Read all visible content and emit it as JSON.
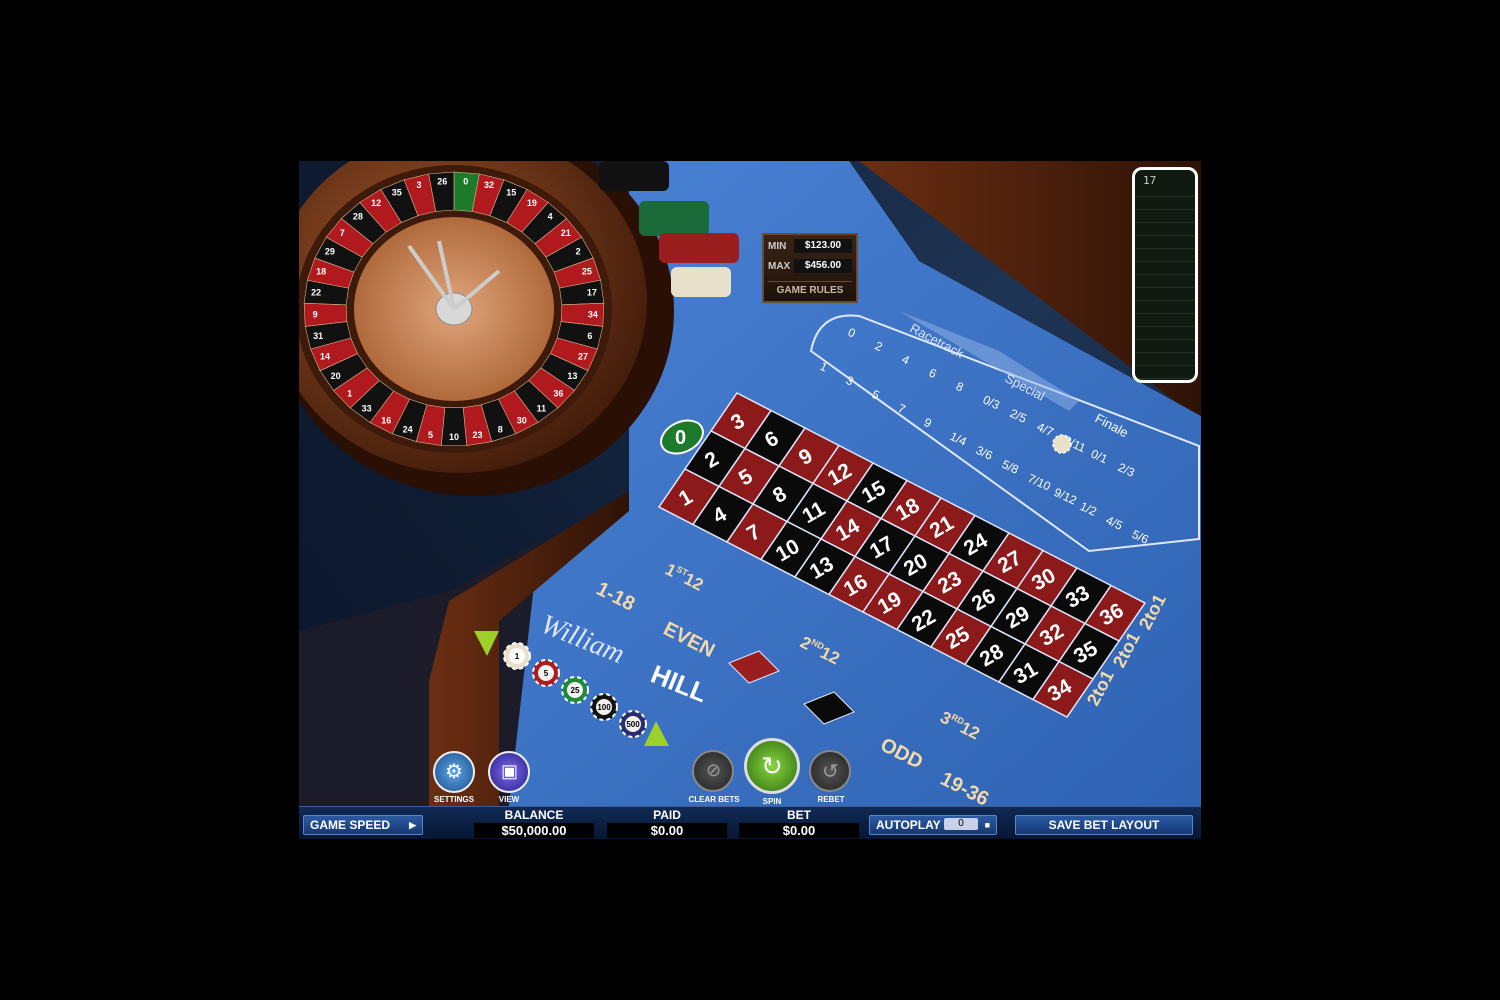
{
  "table": {
    "min_label": "MIN",
    "min_value": "$123.00",
    "max_label": "MAX",
    "max_value": "$456.00",
    "rules_label": "GAME RULES",
    "brand_script": "William",
    "brand_bold": "HILL",
    "zero": "0",
    "dozens": [
      {
        "n": "1",
        "sup": "ST",
        "t": "12"
      },
      {
        "n": "2",
        "sup": "ND",
        "t": "12"
      },
      {
        "n": "3",
        "sup": "RD",
        "t": "12"
      }
    ],
    "outside": {
      "low": "1-18",
      "even": "EVEN",
      "odd": "ODD",
      "high": "19-36",
      "column": "2to1"
    },
    "grid_rows": [
      [
        "3",
        "6",
        "9",
        "12",
        "15",
        "18",
        "21",
        "24",
        "27",
        "30",
        "33",
        "36"
      ],
      [
        "2",
        "5",
        "8",
        "11",
        "14",
        "17",
        "20",
        "23",
        "26",
        "29",
        "32",
        "35"
      ],
      [
        "1",
        "4",
        "7",
        "10",
        "13",
        "16",
        "19",
        "22",
        "25",
        "28",
        "31",
        "34"
      ]
    ],
    "red_numbers": [
      1,
      3,
      5,
      7,
      9,
      12,
      14,
      16,
      18,
      19,
      21,
      23,
      25,
      27,
      30,
      32,
      34,
      36
    ]
  },
  "racetrack": {
    "tab_racetrack": "Racetrack",
    "tab_special": "Special",
    "tab_finale": "Finale",
    "top_row": [
      "0",
      "2",
      "4",
      "6",
      "8",
      "0/3",
      "2/5",
      "4/7",
      "8/11",
      "0/1",
      "2/3"
    ],
    "mid_row": [
      "1",
      "3",
      "5",
      "7",
      "9",
      "1/4",
      "3/6",
      "5/8",
      "7/10",
      "9/12",
      "1/2",
      "4/5",
      "5/6"
    ]
  },
  "wheel_numbers": [
    "0",
    "32",
    "15",
    "19",
    "4",
    "21",
    "2",
    "25",
    "17",
    "34",
    "6",
    "27",
    "13",
    "36",
    "11",
    "30",
    "8",
    "23",
    "10",
    "5",
    "24",
    "16",
    "33",
    "1",
    "20",
    "14",
    "31",
    "9",
    "22",
    "18",
    "29",
    "7",
    "28",
    "12",
    "35",
    "3",
    "26"
  ],
  "chips": [
    "1",
    "5",
    "25",
    "100",
    "500"
  ],
  "history": {
    "last": "17"
  },
  "controls": {
    "settings": "SETTINGS",
    "view": "VIEW",
    "clear_bets": "CLEAR BETS",
    "spin": "SPIN",
    "rebet": "REBET"
  },
  "hud": {
    "game_speed": "GAME SPEED",
    "balance_label": "BALANCE",
    "balance_value": "$50,000.00",
    "paid_label": "PAID",
    "paid_value": "$0.00",
    "bet_label": "BET",
    "bet_value": "$0.00",
    "autoplay_label": "AUTOPLAY",
    "autoplay_value": "0",
    "save_layout": "SAVE BET LAYOUT"
  },
  "colors": {
    "felt": "#3f74c6",
    "red": "#8c1a1a",
    "black": "#0a0a0a",
    "green": "#1d7a2a",
    "wood": "#5a2a12"
  }
}
